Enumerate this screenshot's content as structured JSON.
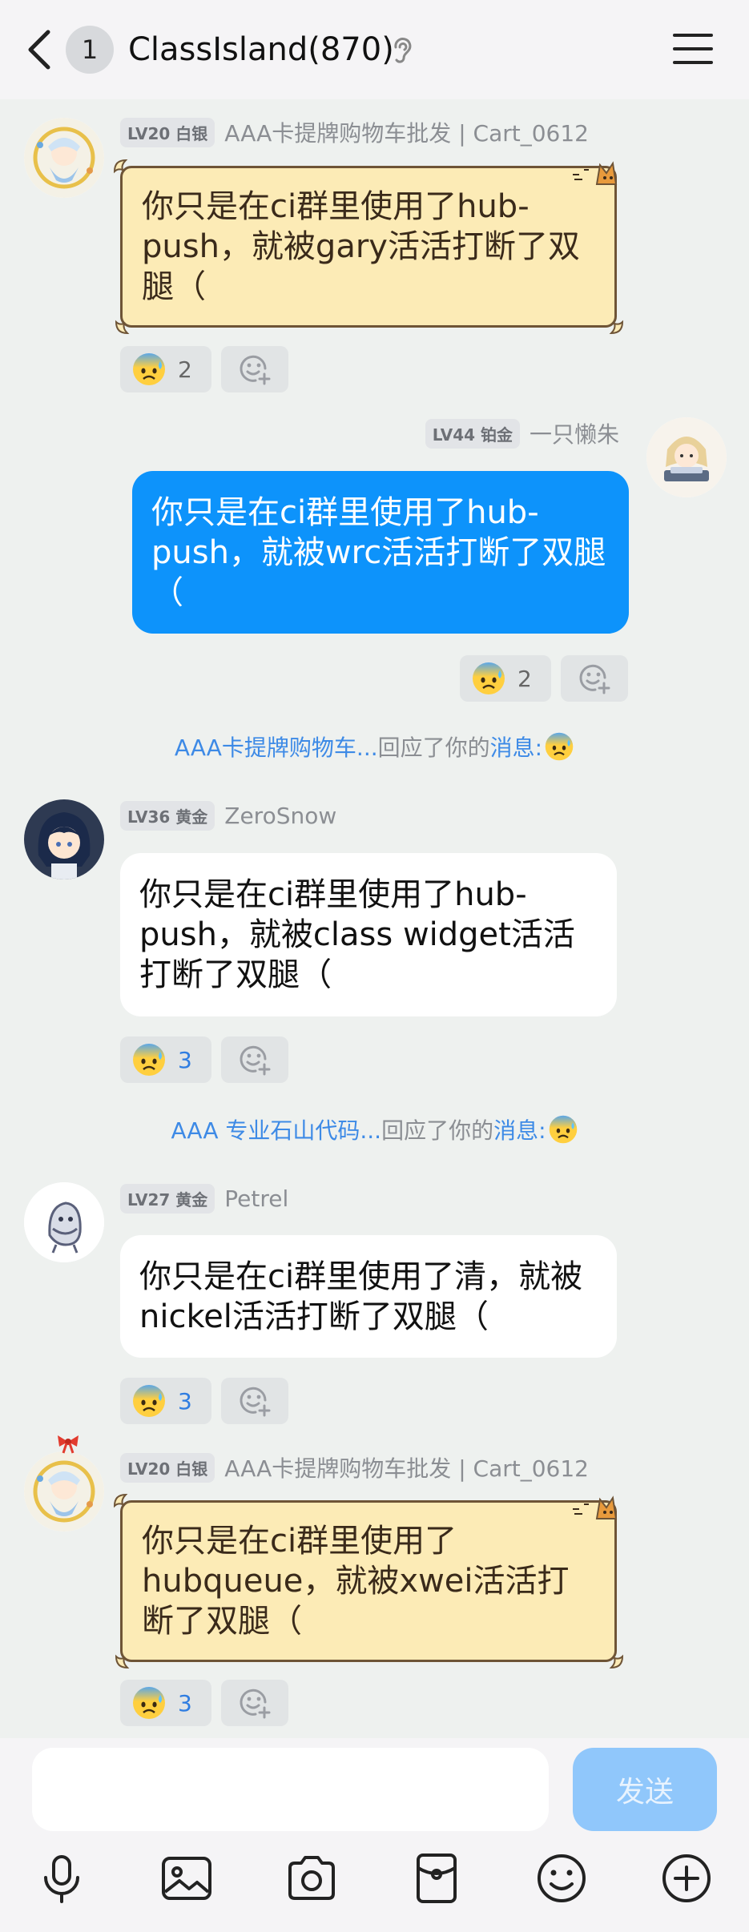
{
  "header": {
    "unread_count": "1",
    "title": "ClassIsland(870)"
  },
  "messages": [
    {
      "level": "LV20 白银",
      "nickname": "AAA卡提牌购物车批发 | Cart_0612",
      "text": "你只是在ci群里使用了hub-push，就被gary活活打断了双腿（",
      "reaction_count": "2"
    },
    {
      "level": "LV44 铂金",
      "nickname": "一只懒朱",
      "text": "你只是在ci群里使用了hub-push，就被wrc活活打断了双腿（",
      "reaction_count": "2"
    },
    {
      "level": "LV36 黄金",
      "nickname": "ZeroSnow",
      "text": "你只是在ci群里使用了hub-push，就被class widget活活打断了双腿（",
      "reaction_count": "3"
    },
    {
      "level": "LV27 黄金",
      "nickname": "Petrel",
      "text": "你只是在ci群里使用了清，就被nickel活活打断了双腿（",
      "reaction_count": "3"
    },
    {
      "level": "LV20 白银",
      "nickname": "AAA卡提牌购物车批发 | Cart_0612",
      "text": "你只是在ci群里使用了hubqueue，就被xwei活活打断了双腿（",
      "reaction_count": "3"
    }
  ],
  "notices": [
    {
      "actor": "AAA卡提牌购物车...",
      "middle": "回应了你的",
      "link": "消息:"
    },
    {
      "actor": "AAA 专业石山代码...",
      "middle": "回应了你的",
      "link": "消息:"
    }
  ],
  "input": {
    "value": "",
    "placeholder": ""
  },
  "send_label": "发送",
  "icons": {
    "back": "chevron-left-icon",
    "ear": "ear-icon",
    "menu": "menu-icon",
    "reaction": "anxious-sweat-face-emoji",
    "add_reaction": "add-emoji-icon",
    "toolbar": [
      "microphone-icon",
      "image-icon",
      "camera-icon",
      "red-packet-icon",
      "emoji-icon",
      "plus-icon"
    ]
  },
  "colors": {
    "blue_bubble": "#0d93fb",
    "card_bubble": "#fcebb6",
    "send_button": "#90c7fb",
    "link_blue": "#3d8ae6"
  }
}
